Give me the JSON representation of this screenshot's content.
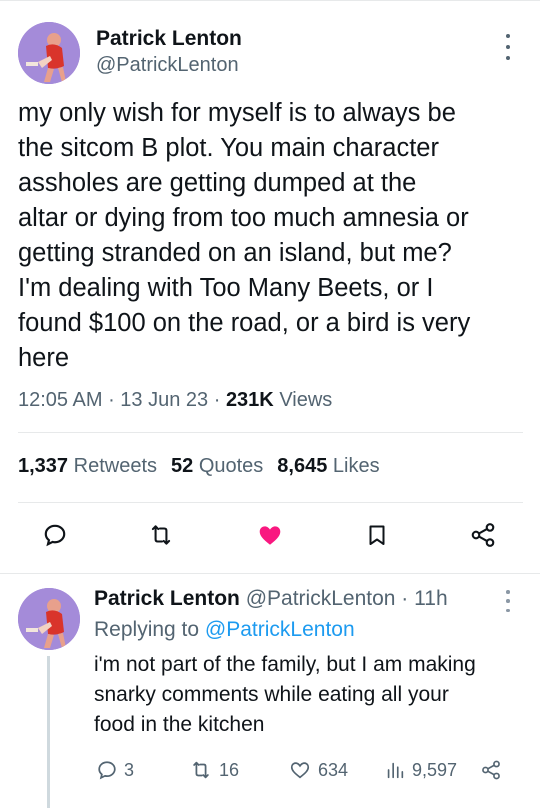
{
  "main_tweet": {
    "author_name": "Patrick Lenton",
    "author_handle": "@PatrickLenton",
    "text_lines": [
      "my only wish for myself is to always be",
      "the sitcom B plot. You main character",
      "assholes are getting dumped at the",
      "altar or dying from too much amnesia or",
      "getting stranded on an island, but me?",
      "I'm dealing with Too Many Beets, or I",
      "found $100 on the road, or a bird is very",
      "here"
    ],
    "time": "12:05 AM",
    "date": "13 Jun 23",
    "views_count": "231K",
    "views_label": "Views",
    "retweets_count": "1,337",
    "retweets_label": "Retweets",
    "quotes_count": "52",
    "quotes_label": "Quotes",
    "likes_count": "8,645",
    "likes_label": "Likes",
    "actions": [
      "reply-icon",
      "retweet-icon",
      "heart-icon",
      "bookmark-icon",
      "share-icon"
    ],
    "liked": true
  },
  "reply": {
    "author_name": "Patrick Lenton",
    "author_handle": "@PatrickLenton",
    "separator": "·",
    "time_ago": "11h",
    "replying_prefix": "Replying to",
    "replying_to": "@PatrickLenton",
    "text_lines": [
      "i'm not part of the family, but I am making",
      "snarky comments while eating all your",
      "food in the kitchen"
    ],
    "replies": "3",
    "retweets": "16",
    "likes": "634",
    "views": "9,597"
  },
  "colors": {
    "text": "#0f1419",
    "secondary": "#536471",
    "link": "#1d9bf0",
    "like": "#f91880",
    "divider": "#e7e9ea"
  }
}
